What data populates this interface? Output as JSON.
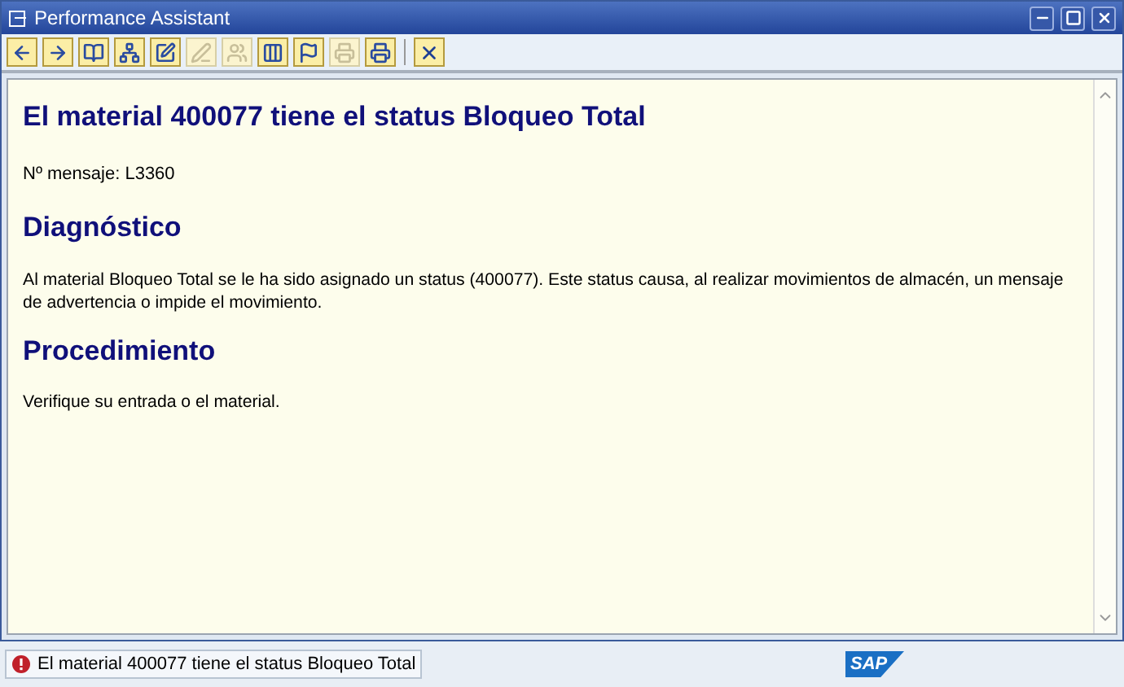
{
  "window": {
    "title": "Performance Assistant"
  },
  "toolbar": [
    {
      "kind": "back",
      "disabled": false
    },
    {
      "kind": "forward",
      "disabled": false
    },
    {
      "kind": "book",
      "disabled": false
    },
    {
      "kind": "structure",
      "disabled": false
    },
    {
      "kind": "edit",
      "disabled": false
    },
    {
      "kind": "pen",
      "disabled": true
    },
    {
      "kind": "people",
      "disabled": true
    },
    {
      "kind": "columns",
      "disabled": false
    },
    {
      "kind": "flag",
      "disabled": false
    },
    {
      "kind": "printer",
      "disabled": true
    },
    {
      "kind": "print",
      "disabled": false
    },
    {
      "kind": "close",
      "disabled": false
    }
  ],
  "content": {
    "title": "El material 400077 tiene el status Bloqueo Total",
    "message_number": "Nº mensaje: L3360",
    "sections": [
      {
        "heading": "Diagnóstico",
        "text": "Al material Bloqueo Total se le ha sido asignado un status (400077). Este status causa, al realizar movimientos de almacén, un mensaje de advertencia o impide el movimiento."
      },
      {
        "heading": "Procedimiento",
        "text": "Verifique su entrada o el material."
      }
    ]
  },
  "status_bar": {
    "kind": "error",
    "message": "El material 400077 tiene el status Bloqueo Total"
  },
  "logo": {
    "text": "SAP"
  }
}
